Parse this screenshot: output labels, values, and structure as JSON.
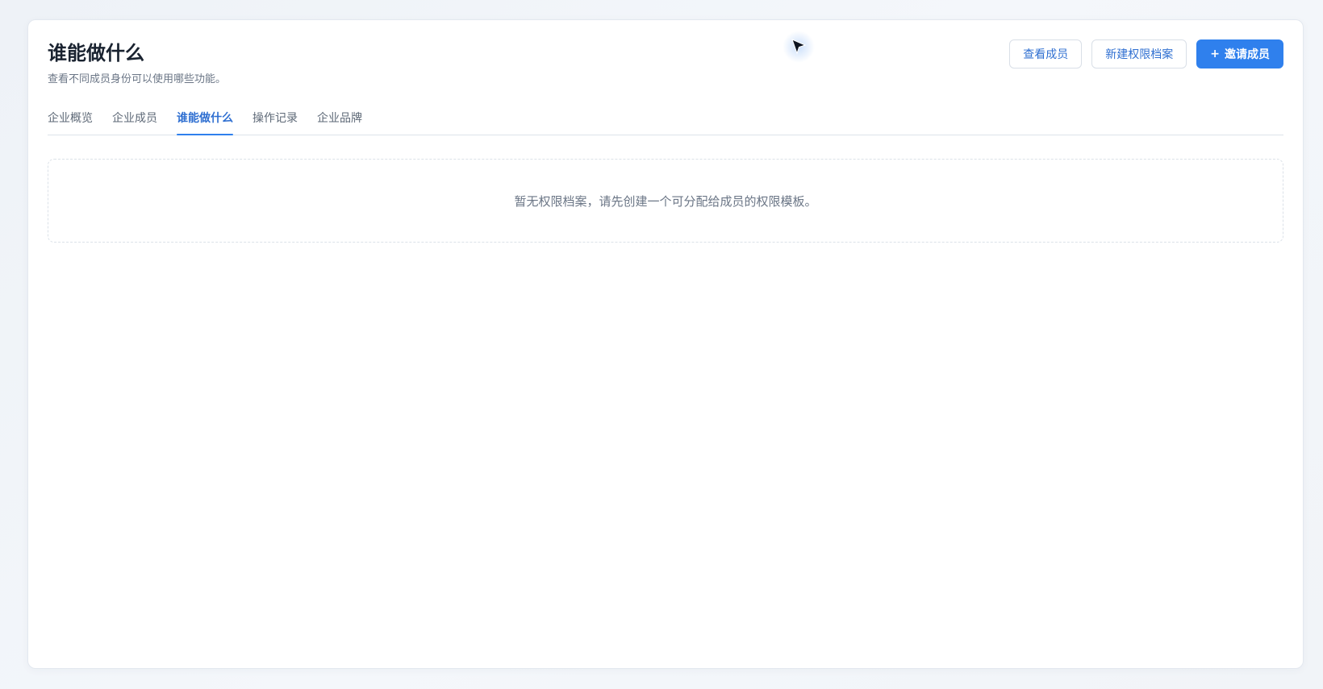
{
  "header": {
    "title": "谁能做什么",
    "subtitle": "查看不同成员身份可以使用哪些功能。"
  },
  "actions": {
    "view_members": "查看成员",
    "new_profile": "新建权限档案",
    "invite_plus": "+",
    "invite_label": "邀请成员"
  },
  "tabs": [
    {
      "label": "企业概览",
      "active": false
    },
    {
      "label": "企业成员",
      "active": false
    },
    {
      "label": "谁能做什么",
      "active": true
    },
    {
      "label": "操作记录",
      "active": false
    },
    {
      "label": "企业品牌",
      "active": false
    }
  ],
  "empty_state": {
    "message": "暂无权限档案，请先创建一个可分配给成员的权限模板。"
  },
  "colors": {
    "accent": "#2f80ed",
    "title": "#1a2330",
    "muted": "#6b7686"
  },
  "icons": {
    "cursor": "cursor-arrow-icon",
    "plus": "plus-icon"
  }
}
